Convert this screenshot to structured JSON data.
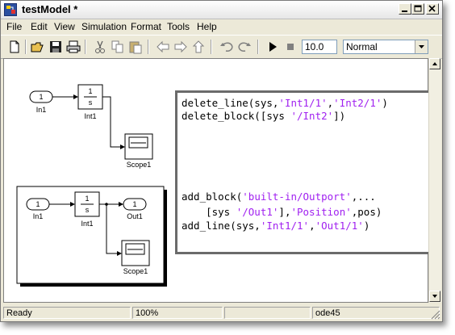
{
  "window": {
    "title": "testModel *"
  },
  "menu": [
    "File",
    "Edit",
    "View",
    "Simulation",
    "Format",
    "Tools",
    "Help"
  ],
  "toolbar": {
    "stop_time": "10.0",
    "sim_mode": "Normal",
    "icons": [
      "new-icon",
      "open-icon",
      "save-icon",
      "print-icon",
      "cut-icon",
      "copy-icon",
      "paste-icon",
      "back-icon",
      "forward-icon",
      "up-icon",
      "undo-icon",
      "redo-icon",
      "run-icon",
      "stop-icon"
    ]
  },
  "model_top": {
    "in_port": "1",
    "in_label": "In1",
    "integrator_num": "1",
    "integrator_den": "s",
    "integrator_label": "Int1",
    "scope_label": "Scope1"
  },
  "model_bottom": {
    "in_port": "1",
    "in_label": "In1",
    "integrator_num": "1",
    "integrator_den": "s",
    "integrator_label": "Int1",
    "out_port": "1",
    "out_label": "Out1",
    "scope_label": "Scope1"
  },
  "code": {
    "line1": {
      "pre": "delete_line(sys,",
      "s1": "'Int1/1'",
      "mid": ",",
      "s2": "'Int2/1'",
      "post": ")"
    },
    "line2": {
      "pre": "delete_block([sys ",
      "s1": "'/Int2'",
      "post": "])"
    },
    "line3": {
      "pre": "add_block(",
      "s1": "'built-in/Outport'",
      "post": ",..."
    },
    "line4": {
      "pre": "    [sys ",
      "s1": "'/Out1'",
      "mid": "],",
      "s2": "'Position'",
      "post": ",pos)"
    },
    "line5": {
      "pre": "add_line(sys,",
      "s1": "'Int1/1'",
      "mid": ",",
      "s2": "'Out1/1'",
      "post": ")"
    }
  },
  "status": {
    "ready": "Ready",
    "zoom": "100%",
    "solver": "ode45"
  }
}
